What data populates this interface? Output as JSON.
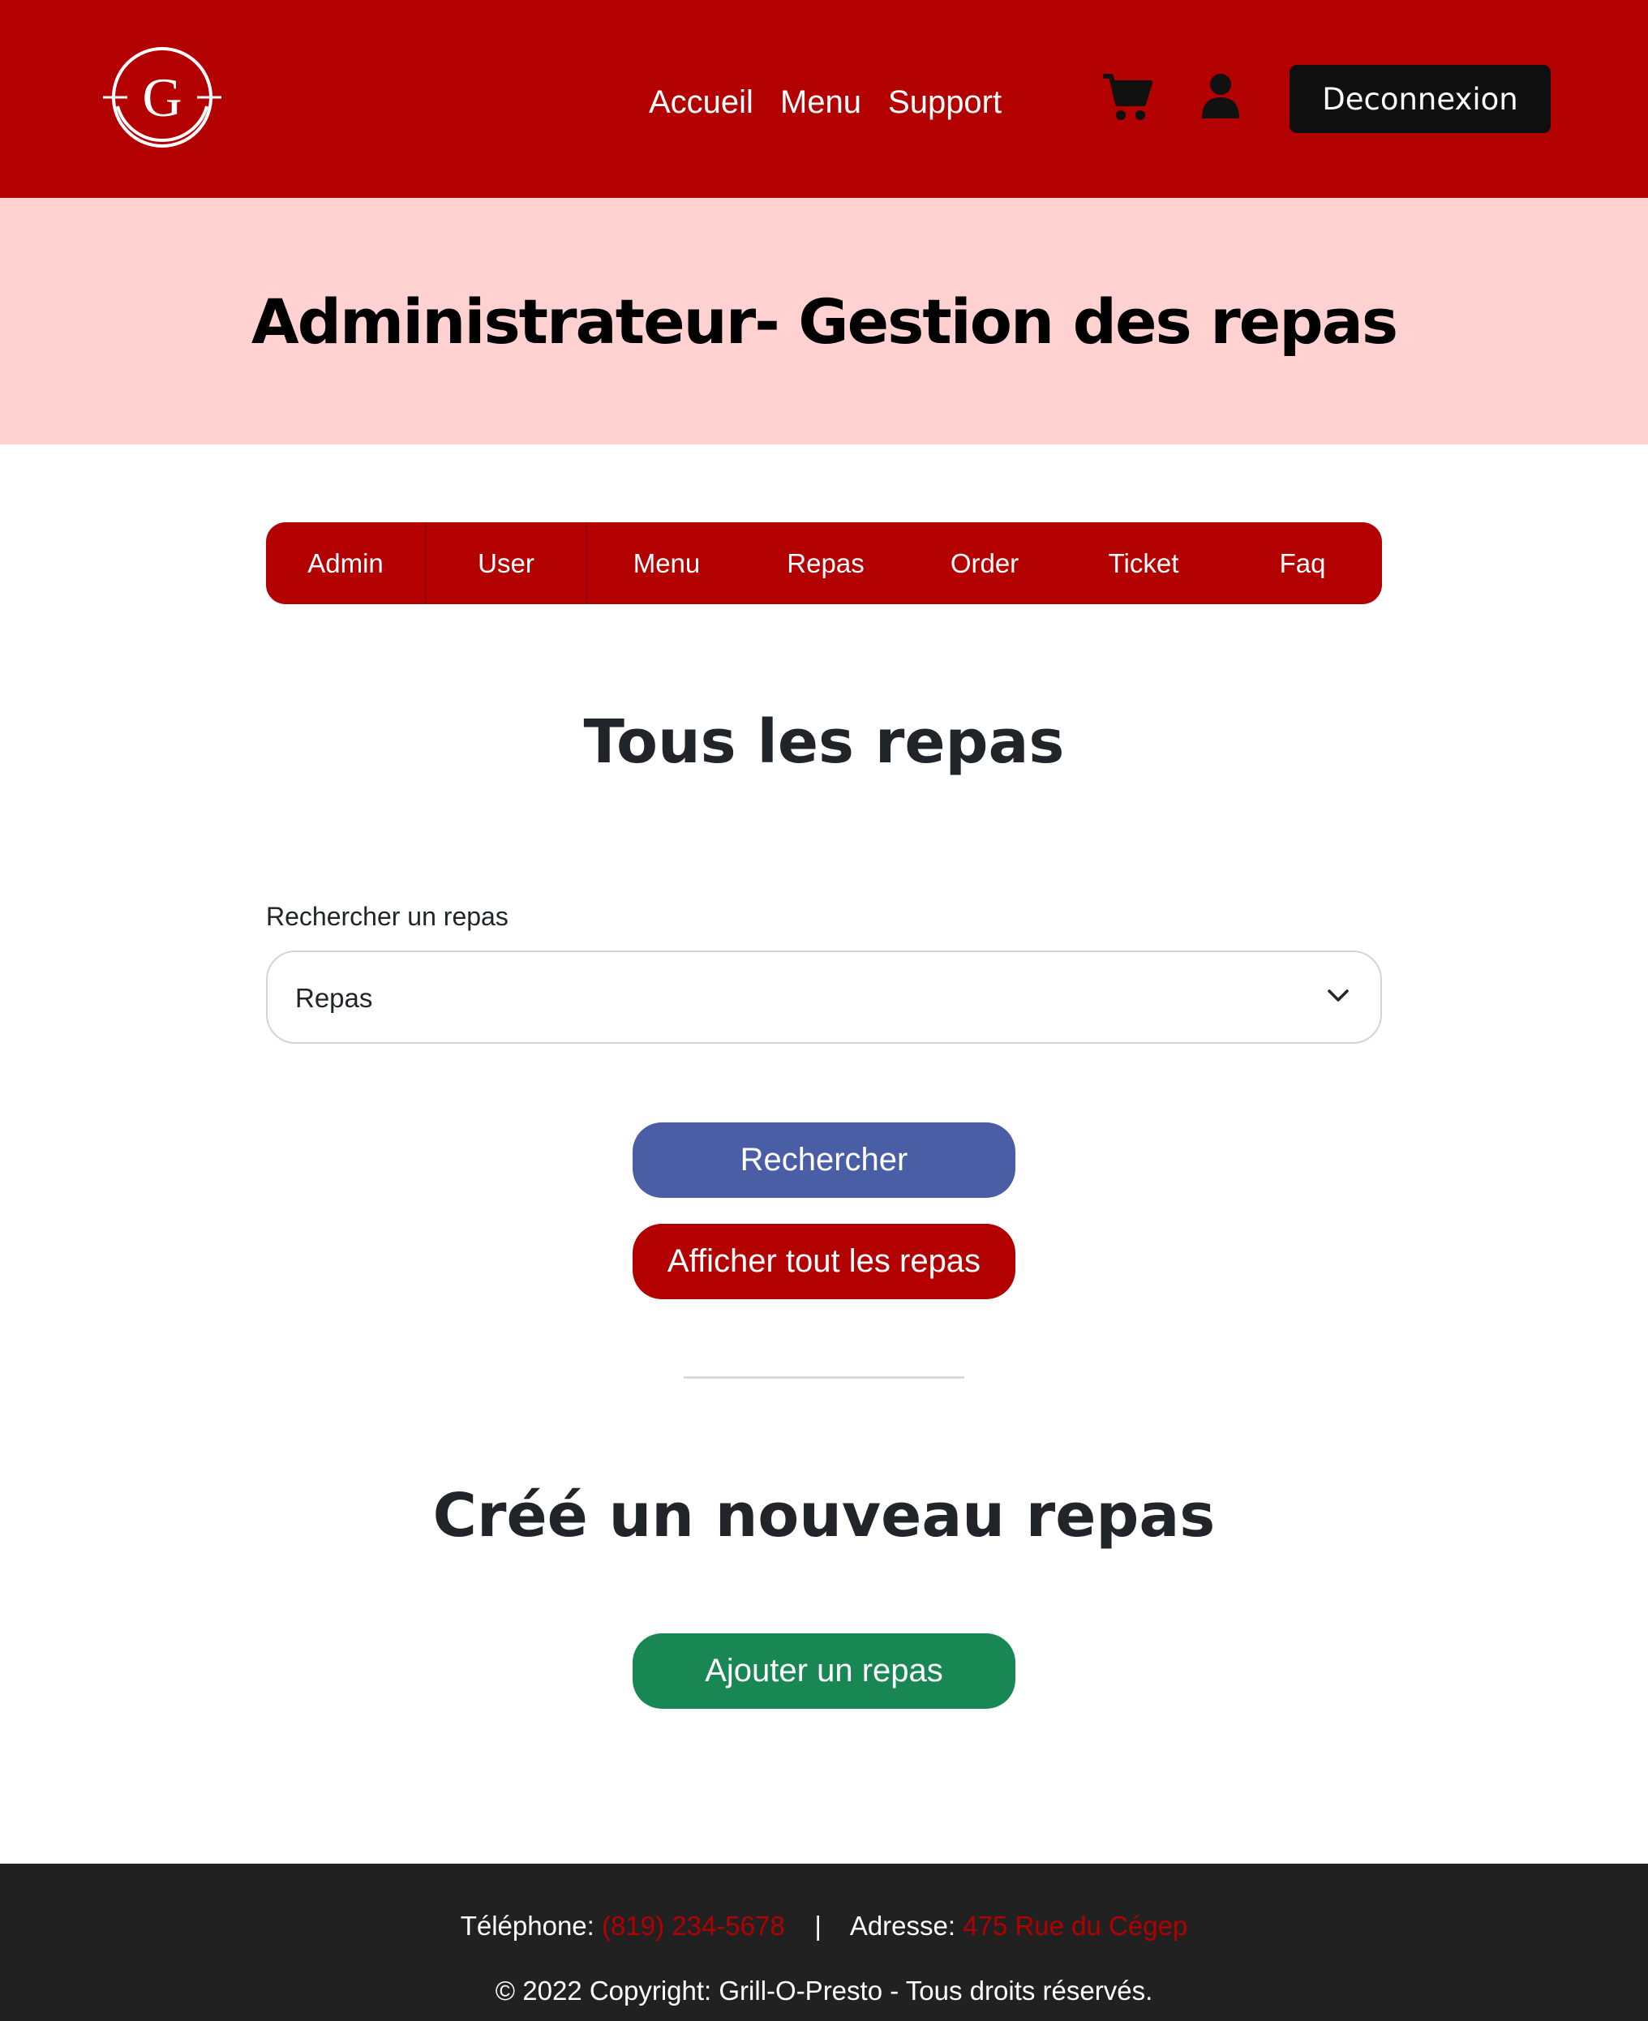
{
  "navbar": {
    "logo_letter": "G",
    "links": [
      "Accueil",
      "Menu",
      "Support"
    ],
    "icons": [
      "cart-icon",
      "user-icon"
    ],
    "logout_label": "Deconnexion"
  },
  "hero": {
    "title": "Administrateur- Gestion des repas"
  },
  "tabs": [
    "Admin",
    "User",
    "Menu",
    "Repas",
    "Order",
    "Ticket",
    "Faq"
  ],
  "list_section": {
    "title": "Tous les repas",
    "search_label": "Rechercher un repas",
    "select_value": "Repas",
    "search_button": "Rechercher",
    "show_all_button": "Afficher tout les repas"
  },
  "create_section": {
    "title": "Créé un nouveau repas",
    "add_button": "Ajouter un repas"
  },
  "footer": {
    "phone_label": "Téléphone: ",
    "phone_value": "(819) 234-5678",
    "separator": "|",
    "address_label": "Adresse: ",
    "address_value": "475 Rue du Cégep",
    "copyright": "© 2022 Copyright: Grill-O-Presto - Tous droits réservés."
  },
  "colors": {
    "brand_red": "#b30000",
    "hero_pink": "#ffd1d1",
    "search_blue": "#4a5ea6",
    "add_green": "#198754",
    "footer_dark": "#212121"
  }
}
